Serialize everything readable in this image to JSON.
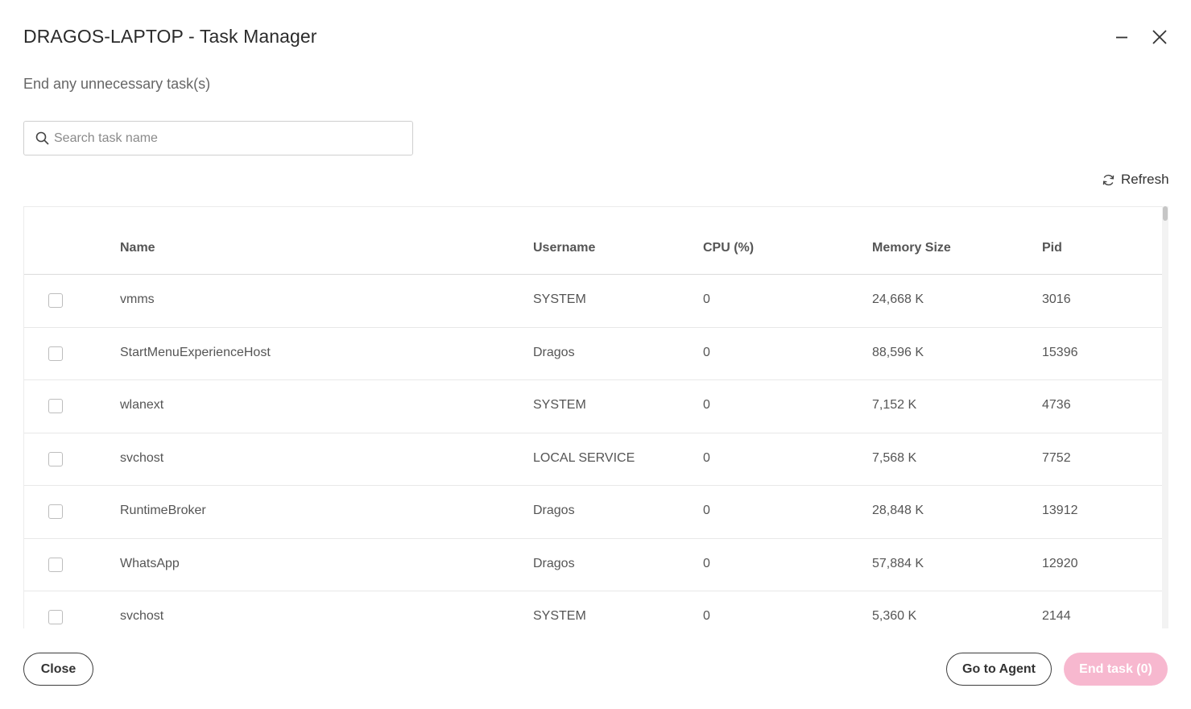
{
  "window": {
    "title": "DRAGOS-LAPTOP - Task Manager",
    "icons": {
      "minimize": "minimize-icon",
      "close": "close-icon"
    }
  },
  "subtitle": "End any unnecessary task(s)",
  "search": {
    "placeholder": "Search task name",
    "value": "",
    "icon": "search-icon"
  },
  "refresh": {
    "label": "Refresh",
    "icon": "refresh-icon"
  },
  "table": {
    "columns": {
      "name": "Name",
      "username": "Username",
      "cpu": "CPU (%)",
      "memory": "Memory Size",
      "pid": "Pid"
    },
    "rows": [
      {
        "name": "vmms",
        "username": "SYSTEM",
        "cpu": "0",
        "memory": "24,668 K",
        "pid": "3016",
        "checked": false
      },
      {
        "name": "StartMenuExperienceHost",
        "username": "Dragos",
        "cpu": "0",
        "memory": "88,596 K",
        "pid": "15396",
        "checked": false
      },
      {
        "name": "wlanext",
        "username": "SYSTEM",
        "cpu": "0",
        "memory": "7,152 K",
        "pid": "4736",
        "checked": false
      },
      {
        "name": "svchost",
        "username": "LOCAL SERVICE",
        "cpu": "0",
        "memory": "7,568 K",
        "pid": "7752",
        "checked": false
      },
      {
        "name": "RuntimeBroker",
        "username": "Dragos",
        "cpu": "0",
        "memory": "28,848 K",
        "pid": "13912",
        "checked": false
      },
      {
        "name": "WhatsApp",
        "username": "Dragos",
        "cpu": "0",
        "memory": "57,884 K",
        "pid": "12920",
        "checked": false
      },
      {
        "name": "svchost",
        "username": "SYSTEM",
        "cpu": "0",
        "memory": "5,360 K",
        "pid": "2144",
        "checked": false
      }
    ]
  },
  "footer": {
    "close_label": "Close",
    "agent_label": "Go to Agent",
    "end_task_label": "End task (0)"
  },
  "colors": {
    "accent_disabled": "#f7b8cf",
    "text": "#333333",
    "muted": "#666666"
  }
}
